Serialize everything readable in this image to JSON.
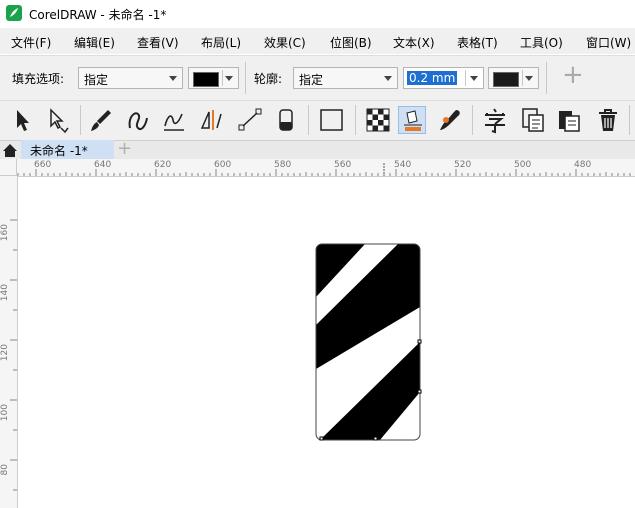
{
  "window": {
    "title": "CorelDRAW - 未命名 -1*"
  },
  "menu": [
    "文件(F)",
    "编辑(E)",
    "查看(V)",
    "布局(L)",
    "效果(C)",
    "位图(B)",
    "文本(X)",
    "表格(T)",
    "工具(O)",
    "窗口(W)"
  ],
  "property_bar": {
    "fill_label": "填充选项:",
    "fill_type": "指定",
    "fill_color": "#000000",
    "outline_label": "轮廓:",
    "outline_type": "指定",
    "outline_width": "0.2 mm",
    "outline_color": "#1a1a1a",
    "add_symbol": "+"
  },
  "tools": [
    "pick-tool",
    "shape-tool",
    "artistic-media-tool",
    "freehand-tool",
    "smart-drawing-tool",
    "dimension-tool",
    "connector-tool",
    "eraser-tool",
    "rectangle-tool",
    "transparency-tool",
    "fill-tool",
    "eyedropper-tool",
    "text-tool",
    "align-tool",
    "paste-tool",
    "delete-tool"
  ],
  "tabs": {
    "home_icon": "home-icon",
    "document": "未命名 -1*",
    "add": "+"
  },
  "ruler": {
    "horizontal": [
      "660",
      "640",
      "620",
      "600",
      "580",
      "560",
      "540",
      "520",
      "500",
      "480"
    ],
    "vertical": [
      "160",
      "140",
      "120",
      "100",
      "80"
    ]
  },
  "accent": "#1e6fd0"
}
